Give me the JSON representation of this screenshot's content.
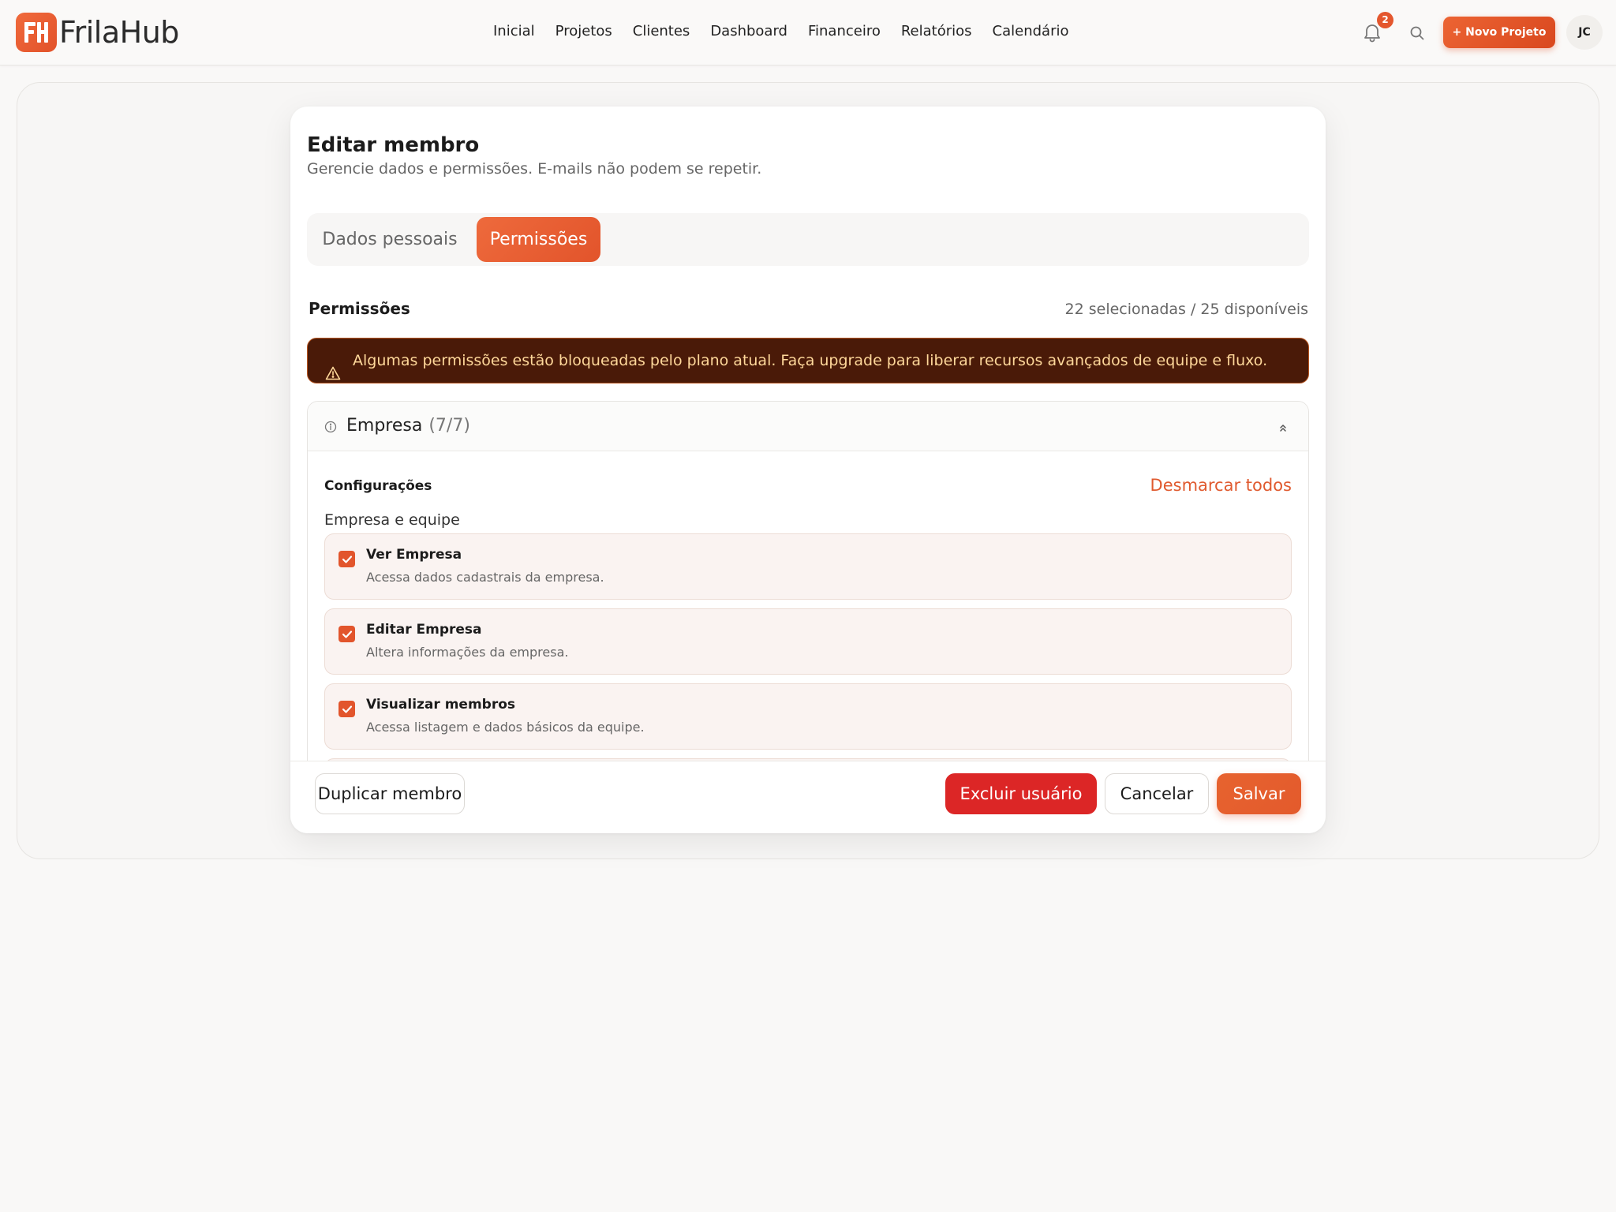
{
  "app": {
    "name": "FrilaHub"
  },
  "nav": {
    "items": [
      {
        "label": "Inicial"
      },
      {
        "label": "Projetos"
      },
      {
        "label": "Clientes"
      },
      {
        "label": "Dashboard"
      },
      {
        "label": "Financeiro"
      },
      {
        "label": "Relatórios"
      },
      {
        "label": "Calendário"
      }
    ]
  },
  "header": {
    "notification_count": "2",
    "new_project_label": "+ Novo Projeto",
    "avatar_initials": "JC",
    "icons": {
      "notifications": "bell-icon",
      "search": "search-icon"
    }
  },
  "modal": {
    "title": "Editar membro",
    "subtitle": "Gerencie dados e permissões. E-mails não podem se repetir.",
    "tabs": [
      {
        "label": "Dados pessoais",
        "active": false
      },
      {
        "label": "Permissões",
        "active": true
      }
    ],
    "permissions": {
      "heading": "Permissões",
      "count_text": "22 selecionadas / 25 disponíveis",
      "selected": 22,
      "available": 25,
      "alert": "Algumas permissões estão bloqueadas pelo plano atual. Faça upgrade para liberar recursos avançados de equipe e fluxo.",
      "group": {
        "name": "Empresa",
        "count": "(7/7)",
        "expanded": true,
        "section": "Configurações",
        "uncheck_all": "Desmarcar todos",
        "subsection": "Empresa e equipe",
        "items": [
          {
            "name": "Ver Empresa",
            "description": "Acessa dados cadastrais da empresa.",
            "checked": true
          },
          {
            "name": "Editar Empresa",
            "description": "Altera informações da empresa.",
            "checked": true
          },
          {
            "name": "Visualizar membros",
            "description": "Acessa listagem e dados básicos da equipe.",
            "checked": true
          }
        ]
      }
    },
    "footer": {
      "duplicate": "Duplicar membro",
      "delete": "Excluir usuário",
      "cancel": "Cancelar",
      "save": "Salvar"
    }
  },
  "colors": {
    "accent": "#e2552c",
    "danger": "#dc2626",
    "alert_bg": "#4a1a08",
    "alert_text": "#ffd89a"
  }
}
